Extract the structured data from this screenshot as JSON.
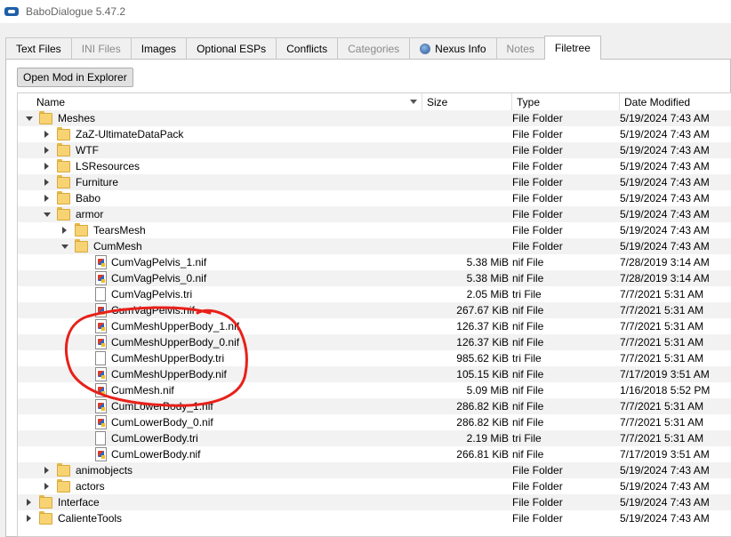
{
  "window": {
    "title": "BaboDialogue 5.47.2"
  },
  "tabs": [
    {
      "label": "Text Files",
      "disabled": false,
      "active": false
    },
    {
      "label": "INI Files",
      "disabled": true,
      "active": false
    },
    {
      "label": "Images",
      "disabled": false,
      "active": false
    },
    {
      "label": "Optional ESPs",
      "disabled": false,
      "active": false
    },
    {
      "label": "Conflicts",
      "disabled": false,
      "active": false
    },
    {
      "label": "Categories",
      "disabled": true,
      "active": false
    },
    {
      "label": "Nexus Info",
      "disabled": false,
      "active": false,
      "icon": "globe-icon"
    },
    {
      "label": "Notes",
      "disabled": true,
      "active": false
    },
    {
      "label": "Filetree",
      "disabled": false,
      "active": true
    }
  ],
  "toolbar": {
    "open_mod_label": "Open Mod in Explorer"
  },
  "columns": {
    "name": "Name",
    "size": "Size",
    "type": "Type",
    "date": "Date Modified"
  },
  "rows": [
    {
      "name": "Meshes",
      "size": "",
      "type": "File Folder",
      "date": "5/19/2024 7:43 AM",
      "depth": 0,
      "kind": "folder",
      "toggle": "expanded"
    },
    {
      "name": "ZaZ-UltimateDataPack",
      "size": "",
      "type": "File Folder",
      "date": "5/19/2024 7:43 AM",
      "depth": 1,
      "kind": "folder",
      "toggle": "collapsed"
    },
    {
      "name": "WTF",
      "size": "",
      "type": "File Folder",
      "date": "5/19/2024 7:43 AM",
      "depth": 1,
      "kind": "folder",
      "toggle": "collapsed"
    },
    {
      "name": "LSResources",
      "size": "",
      "type": "File Folder",
      "date": "5/19/2024 7:43 AM",
      "depth": 1,
      "kind": "folder",
      "toggle": "collapsed"
    },
    {
      "name": "Furniture",
      "size": "",
      "type": "File Folder",
      "date": "5/19/2024 7:43 AM",
      "depth": 1,
      "kind": "folder",
      "toggle": "collapsed"
    },
    {
      "name": "Babo",
      "size": "",
      "type": "File Folder",
      "date": "5/19/2024 7:43 AM",
      "depth": 1,
      "kind": "folder",
      "toggle": "collapsed"
    },
    {
      "name": "armor",
      "size": "",
      "type": "File Folder",
      "date": "5/19/2024 7:43 AM",
      "depth": 1,
      "kind": "folder",
      "toggle": "expanded"
    },
    {
      "name": "TearsMesh",
      "size": "",
      "type": "File Folder",
      "date": "5/19/2024 7:43 AM",
      "depth": 2,
      "kind": "folder",
      "toggle": "collapsed"
    },
    {
      "name": "CumMesh",
      "size": "",
      "type": "File Folder",
      "date": "5/19/2024 7:43 AM",
      "depth": 2,
      "kind": "folder",
      "toggle": "expanded"
    },
    {
      "name": "CumVagPelvis_1.nif",
      "size": "5.38 MiB",
      "type": "nif File",
      "date": "7/28/2019 3:14 AM",
      "depth": 3,
      "kind": "nif",
      "toggle": "none"
    },
    {
      "name": "CumVagPelvis_0.nif",
      "size": "5.38 MiB",
      "type": "nif File",
      "date": "7/28/2019 3:14 AM",
      "depth": 3,
      "kind": "nif",
      "toggle": "none"
    },
    {
      "name": "CumVagPelvis.tri",
      "size": "2.05 MiB",
      "type": "tri File",
      "date": "7/7/2021 5:31 AM",
      "depth": 3,
      "kind": "tri",
      "toggle": "none"
    },
    {
      "name": "CumVagPelvis.nif",
      "size": "267.67 KiB",
      "type": "nif File",
      "date": "7/7/2021 5:31 AM",
      "depth": 3,
      "kind": "nif",
      "toggle": "none"
    },
    {
      "name": "CumMeshUpperBody_1.nif",
      "size": "126.37 KiB",
      "type": "nif File",
      "date": "7/7/2021 5:31 AM",
      "depth": 3,
      "kind": "nif",
      "toggle": "none"
    },
    {
      "name": "CumMeshUpperBody_0.nif",
      "size": "126.37 KiB",
      "type": "nif File",
      "date": "7/7/2021 5:31 AM",
      "depth": 3,
      "kind": "nif",
      "toggle": "none"
    },
    {
      "name": "CumMeshUpperBody.tri",
      "size": "985.62 KiB",
      "type": "tri File",
      "date": "7/7/2021 5:31 AM",
      "depth": 3,
      "kind": "tri",
      "toggle": "none"
    },
    {
      "name": "CumMeshUpperBody.nif",
      "size": "105.15 KiB",
      "type": "nif File",
      "date": "7/17/2019 3:51 AM",
      "depth": 3,
      "kind": "nif",
      "toggle": "none"
    },
    {
      "name": "CumMesh.nif",
      "size": "5.09 MiB",
      "type": "nif File",
      "date": "1/16/2018 5:52 PM",
      "depth": 3,
      "kind": "nif",
      "toggle": "none"
    },
    {
      "name": "CumLowerBody_1.nif",
      "size": "286.82 KiB",
      "type": "nif File",
      "date": "7/7/2021 5:31 AM",
      "depth": 3,
      "kind": "nif",
      "toggle": "none"
    },
    {
      "name": "CumLowerBody_0.nif",
      "size": "286.82 KiB",
      "type": "nif File",
      "date": "7/7/2021 5:31 AM",
      "depth": 3,
      "kind": "nif",
      "toggle": "none"
    },
    {
      "name": "CumLowerBody.tri",
      "size": "2.19 MiB",
      "type": "tri File",
      "date": "7/7/2021 5:31 AM",
      "depth": 3,
      "kind": "tri",
      "toggle": "none"
    },
    {
      "name": "CumLowerBody.nif",
      "size": "266.81 KiB",
      "type": "nif File",
      "date": "7/17/2019 3:51 AM",
      "depth": 3,
      "kind": "nif",
      "toggle": "none"
    },
    {
      "name": "animobjects",
      "size": "",
      "type": "File Folder",
      "date": "5/19/2024 7:43 AM",
      "depth": 1,
      "kind": "folder",
      "toggle": "collapsed"
    },
    {
      "name": "actors",
      "size": "",
      "type": "File Folder",
      "date": "5/19/2024 7:43 AM",
      "depth": 1,
      "kind": "folder",
      "toggle": "collapsed"
    },
    {
      "name": "Interface",
      "size": "",
      "type": "File Folder",
      "date": "5/19/2024 7:43 AM",
      "depth": 0,
      "kind": "folder",
      "toggle": "collapsed"
    },
    {
      "name": "CalienteTools",
      "size": "",
      "type": "File Folder",
      "date": "5/19/2024 7:43 AM",
      "depth": 0,
      "kind": "folder",
      "toggle": "collapsed"
    }
  ],
  "annotation": {
    "color": "#e8201a"
  },
  "colors": {
    "row_alt": "#f2f2f2",
    "folder": "#f7d374"
  }
}
